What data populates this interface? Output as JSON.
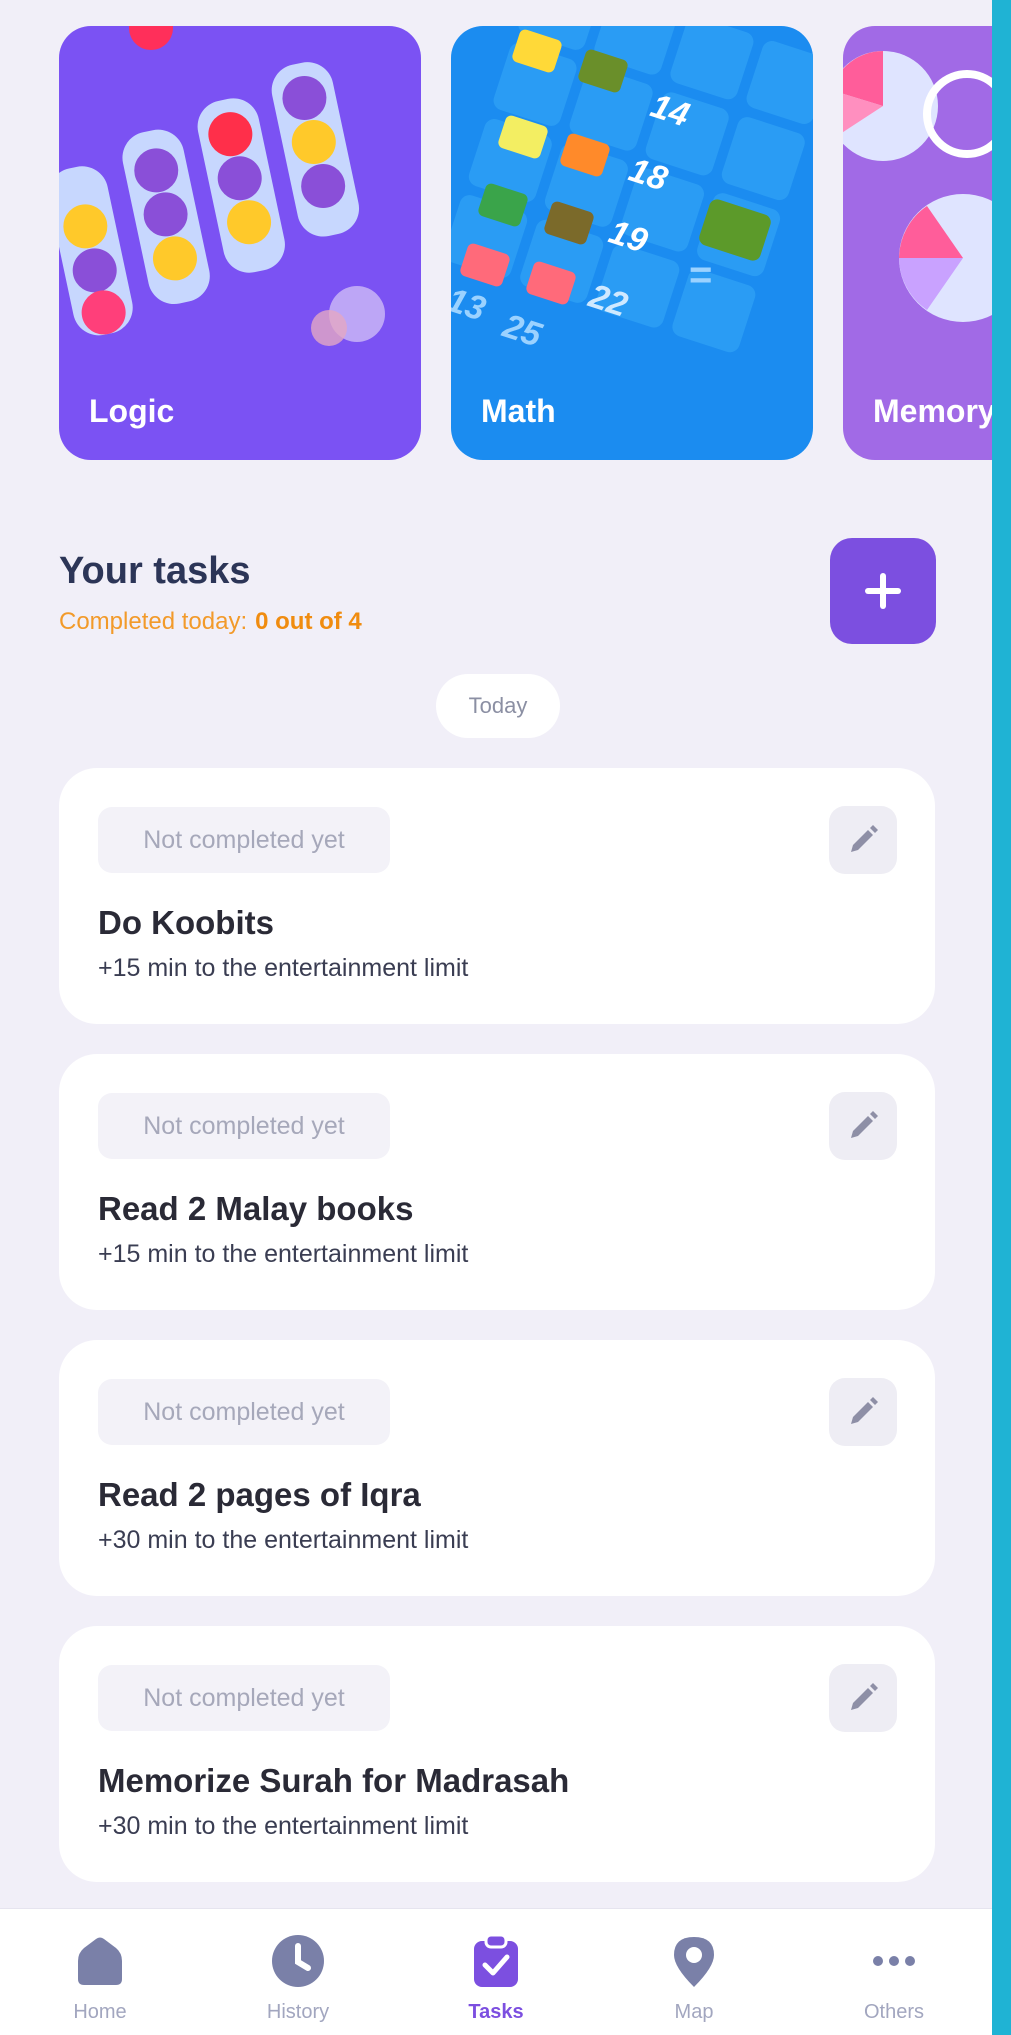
{
  "games": [
    {
      "label": "Logic",
      "color": "#7b52f3"
    },
    {
      "label": "Math",
      "color": "#1b8cf0",
      "numbers": [
        "14",
        "18",
        "19",
        "22",
        "13",
        "25",
        "="
      ]
    },
    {
      "label": "Memory",
      "color": "#a16ae6"
    }
  ],
  "tasks_section": {
    "title": "Your tasks",
    "progress_label": "Completed today:",
    "progress_value": "0 out of 4",
    "add_icon": "plus-icon",
    "date_label": "Today"
  },
  "tasks": [
    {
      "status": "Not completed yet",
      "title": "Do Koobits",
      "reward": "+15 min to the entertainment limit"
    },
    {
      "status": "Not completed yet",
      "title": "Read 2 Malay books",
      "reward": "+15 min to the entertainment limit"
    },
    {
      "status": "Not completed yet",
      "title": "Read 2 pages of Iqra",
      "reward": "+30 min to the entertainment limit"
    },
    {
      "status": "Not completed yet",
      "title": "Memorize Surah for Madrasah",
      "reward": "+30 min to the entertainment limit"
    }
  ],
  "nav": [
    {
      "label": "Home",
      "icon": "home-icon"
    },
    {
      "label": "History",
      "icon": "clock-icon"
    },
    {
      "label": "Tasks",
      "icon": "clipboard-check-icon",
      "active": true
    },
    {
      "label": "Map",
      "icon": "map-pin-icon"
    },
    {
      "label": "Others",
      "icon": "more-dots-icon"
    }
  ],
  "colors": {
    "accent": "#7c4fe0",
    "progress": "#f29a2a",
    "background": "#f1eff8"
  }
}
